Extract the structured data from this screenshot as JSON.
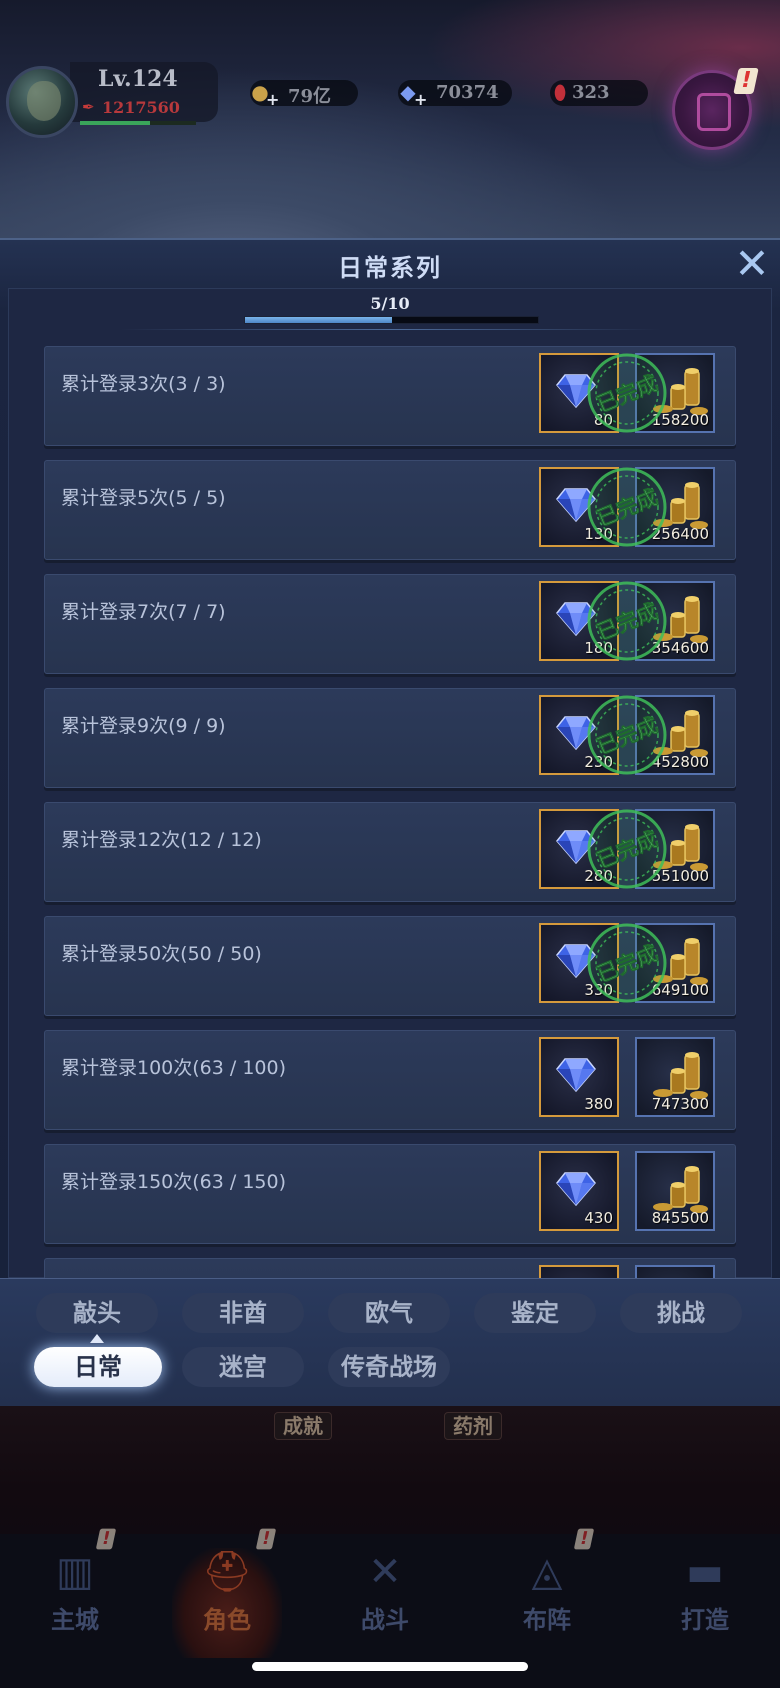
{
  "player": {
    "level": "Lv.124",
    "power": "1217560",
    "hp_fraction": 0.6
  },
  "resources": [
    {
      "name": "gold",
      "value": "79亿",
      "icon": "gold-ingot-icon"
    },
    {
      "name": "diamond",
      "value": "70374",
      "icon": "diamond-icon"
    },
    {
      "name": "ruby",
      "value": "323",
      "icon": "ruby-icon"
    }
  ],
  "panel": {
    "title": "日常系列",
    "close_symbol": "✕",
    "progress_label": "5/10",
    "progress_fraction": 0.5,
    "completed_stamp": "已完成"
  },
  "tasks": [
    {
      "name": "累计登录3次(3 / 3)",
      "gem": "80",
      "coin": "158200",
      "completed": true
    },
    {
      "name": "累计登录5次(5 / 5)",
      "gem": "130",
      "coin": "256400",
      "completed": true
    },
    {
      "name": "累计登录7次(7 / 7)",
      "gem": "180",
      "coin": "354600",
      "completed": true
    },
    {
      "name": "累计登录9次(9 / 9)",
      "gem": "230",
      "coin": "452800",
      "completed": true
    },
    {
      "name": "累计登录12次(12 / 12)",
      "gem": "280",
      "coin": "551000",
      "completed": true
    },
    {
      "name": "累计登录50次(50 / 50)",
      "gem": "330",
      "coin": "649100",
      "completed": true
    },
    {
      "name": "累计登录100次(63 / 100)",
      "gem": "380",
      "coin": "747300",
      "completed": false
    },
    {
      "name": "累计登录150次(63 / 150)",
      "gem": "430",
      "coin": "845500",
      "completed": false
    },
    {
      "name": "",
      "gem": "",
      "coin": "",
      "completed": false
    }
  ],
  "tabs": {
    "row1": [
      "敲头",
      "非酋",
      "欧气",
      "鉴定",
      "挑战"
    ],
    "row2": [
      "日常",
      "迷宫",
      "传奇战场"
    ],
    "active": "日常"
  },
  "background_tags": [
    "成就",
    "药剂"
  ],
  "nav": [
    {
      "label": "主城",
      "icon": "castle-icon"
    },
    {
      "label": "角色",
      "icon": "helmet-icon"
    },
    {
      "label": "战斗",
      "icon": "crossed-swords-icon"
    },
    {
      "label": "布阵",
      "icon": "formation-icon"
    },
    {
      "label": "打造",
      "icon": "anvil-icon"
    }
  ],
  "nav_active": "角色",
  "colors": {
    "gem_slot_border": "#d59a3c",
    "coin_slot_border": "#5673b0",
    "stamp_green": "#3fbf5a",
    "power_red": "#b7393c",
    "progress_blue": "#6aa4e0"
  }
}
